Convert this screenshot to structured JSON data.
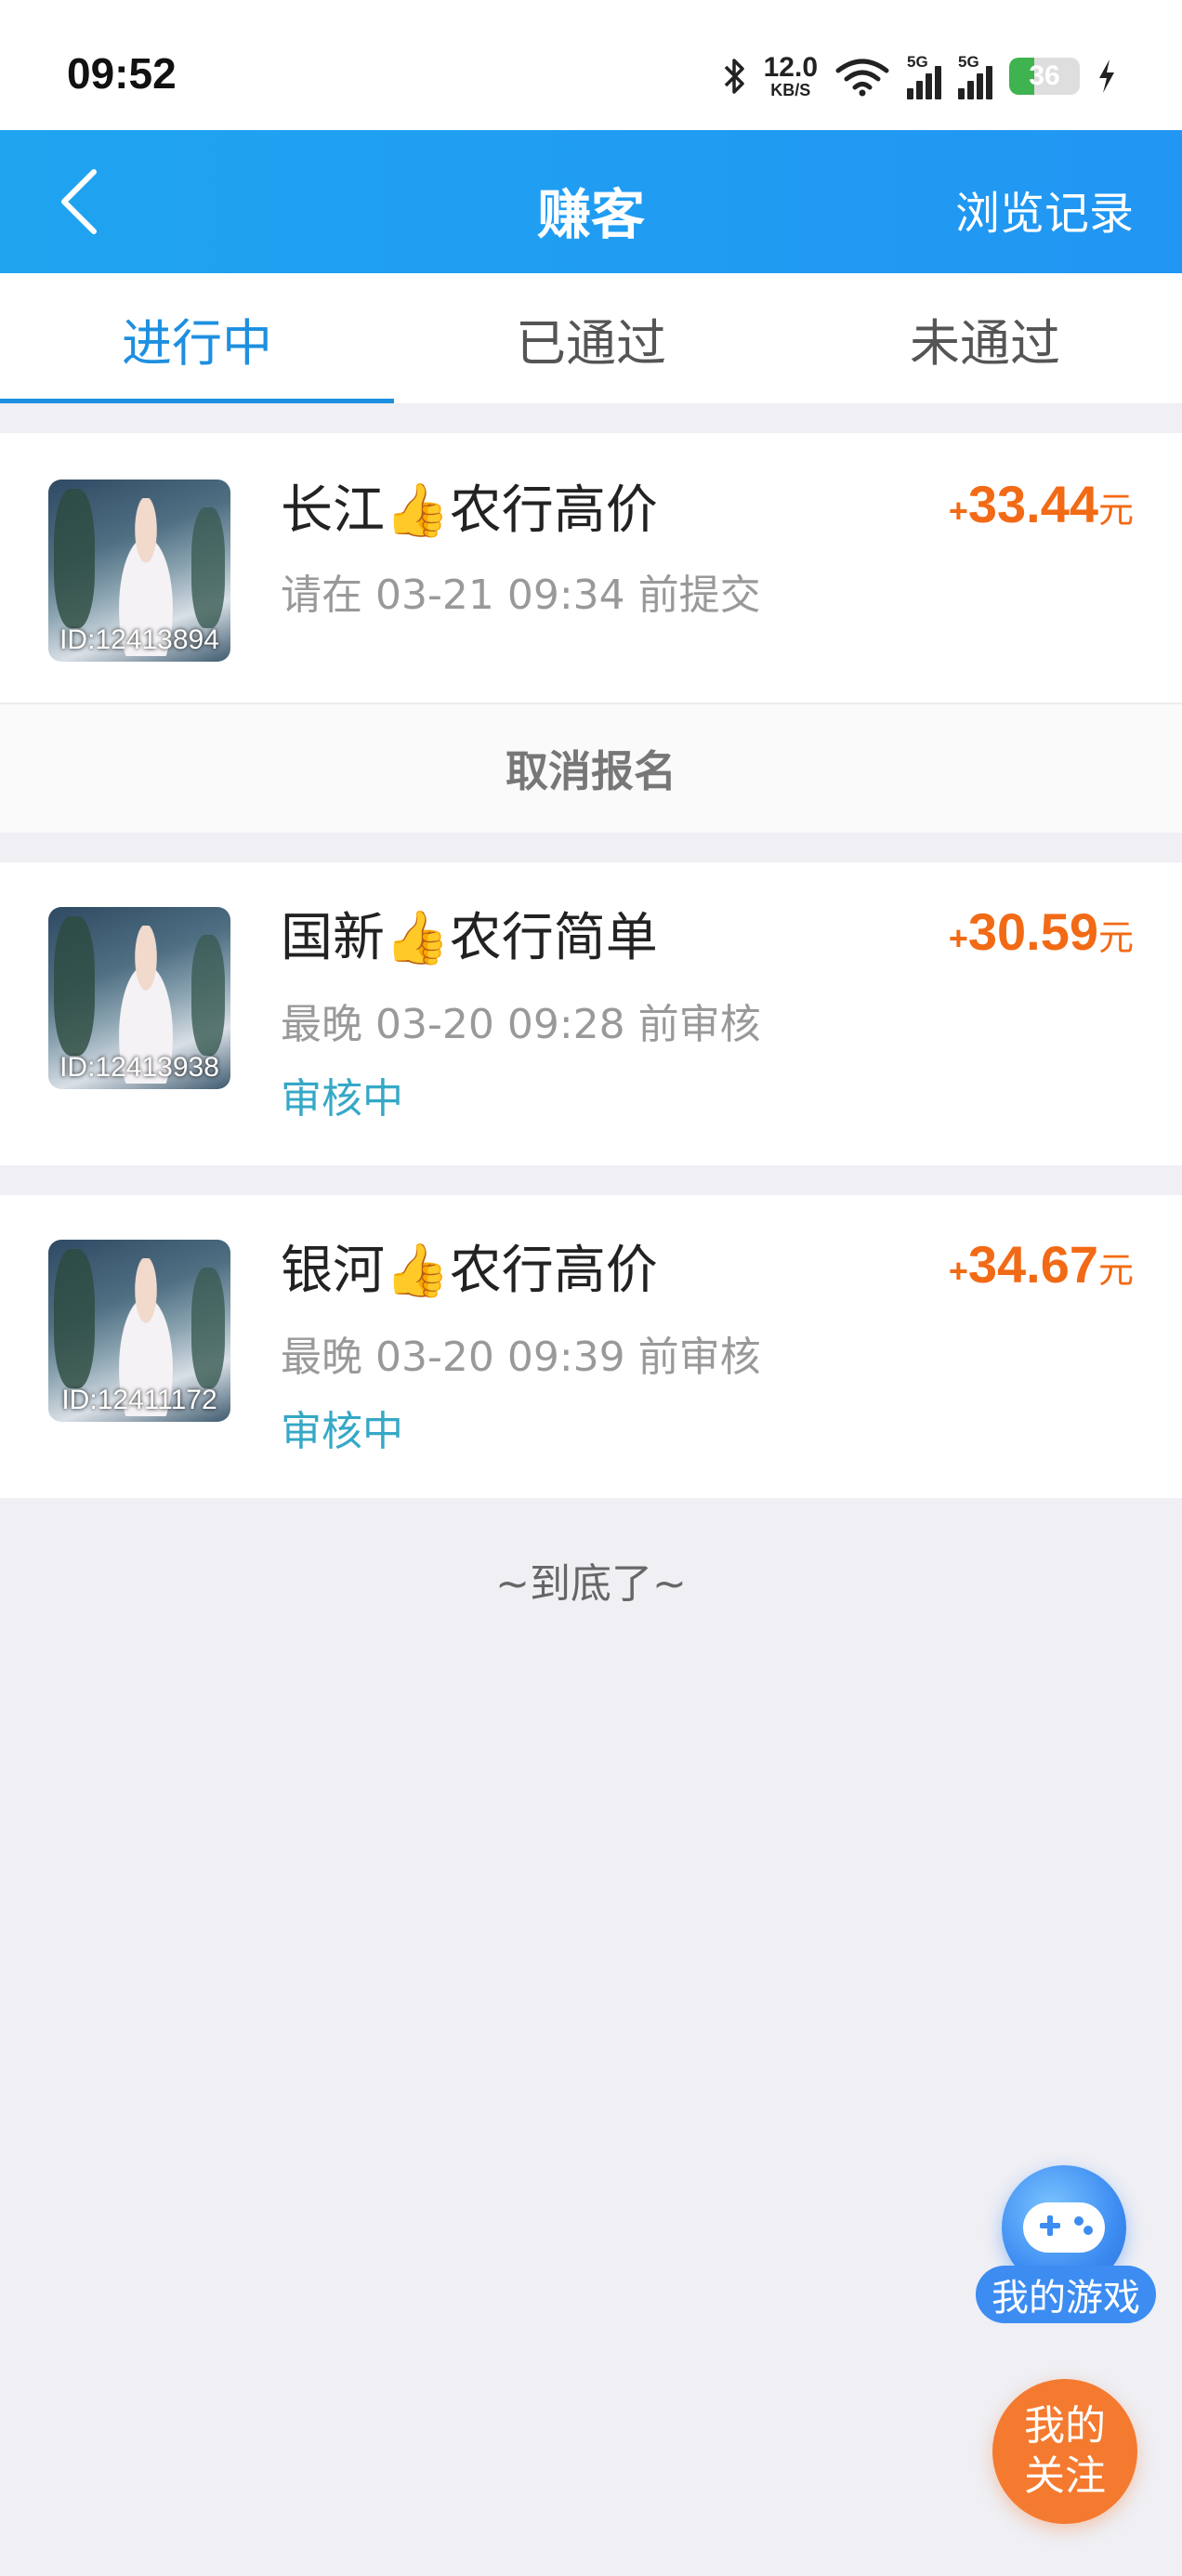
{
  "status_bar": {
    "time": "09:52",
    "speed_value": "12.0",
    "speed_unit": "KB/S",
    "sim1_label": "5G",
    "sim2_label": "5G",
    "battery_level": "36",
    "battery_fraction": 0.36,
    "icons": [
      "bluetooth-icon",
      "wifi-icon",
      "signal-icon",
      "battery-icon",
      "charging-icon"
    ]
  },
  "header": {
    "title": "赚客",
    "right_action": "浏览记录",
    "back_icon": "chevron-left-icon"
  },
  "tabs": [
    {
      "label": "进行中",
      "active": true
    },
    {
      "label": "已通过",
      "active": false
    },
    {
      "label": "未通过",
      "active": false
    }
  ],
  "tasks": [
    {
      "thumb_id": "ID:12413894",
      "title": "长江👍农行高价",
      "subtitle": "请在 03-21 09:34 前提交",
      "status": "",
      "price_plus": "+",
      "price": "33.44",
      "price_unit": "元",
      "action": "取消报名"
    },
    {
      "thumb_id": "ID:12413938",
      "title": "国新👍农行简单",
      "subtitle": "最晚 03-20 09:28 前审核",
      "status": "审核中",
      "price_plus": "+",
      "price": "30.59",
      "price_unit": "元"
    },
    {
      "thumb_id": "ID:12411172",
      "title": "银河👍农行高价",
      "subtitle": "最晚 03-20 09:39 前审核",
      "status": "审核中",
      "price_plus": "+",
      "price": "34.67",
      "price_unit": "元"
    }
  ],
  "list_end": "~到底了~",
  "floating": {
    "games_label": "我的游戏",
    "games_icon": "gamepad-icon",
    "follow_label_1": "我的",
    "follow_label_2": "关注"
  },
  "colors": {
    "nav_blue": "#2196f3",
    "tab_active": "#1e8fe0",
    "price_orange": "#f26a15",
    "status_teal": "#35a8c6",
    "follow_orange": "#f47a30"
  }
}
